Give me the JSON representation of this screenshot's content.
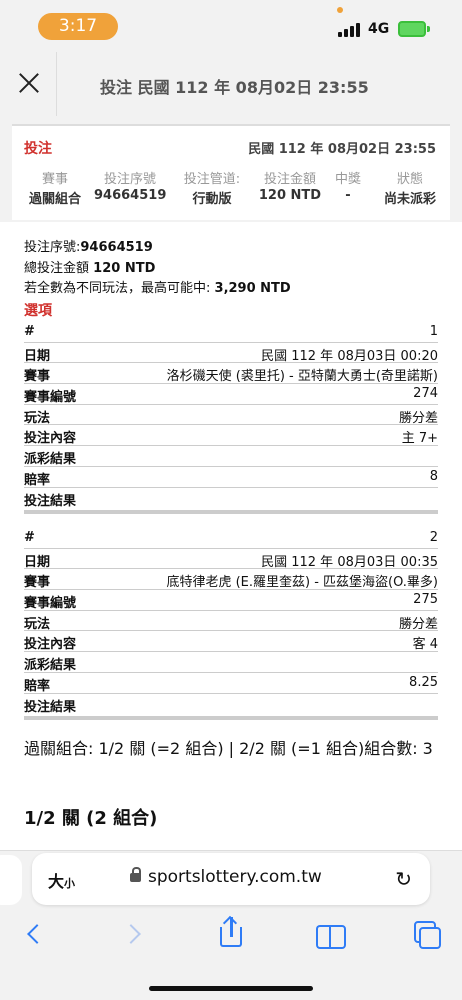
{
  "status_bar": {
    "time": "3:17",
    "network": "4G",
    "accent": "#f0a23a"
  },
  "header": {
    "title": "投注 民國 112 年 08月02日 23:55",
    "close_icon": "close-icon"
  },
  "card": {
    "title": "投注",
    "date": "民國 112 年 08月02日 23:55",
    "columns": [
      {
        "header": "賽事",
        "value": "過關組合"
      },
      {
        "header": "投注序號",
        "value": "94664519"
      },
      {
        "header": "投注管道:",
        "value": "行動版"
      },
      {
        "header": "投注金額",
        "value": "120 NTD"
      },
      {
        "header": "中獎",
        "value": "-"
      },
      {
        "header": "狀態",
        "value": "尚未派彩"
      }
    ]
  },
  "details": {
    "serial_label": "投注序號:",
    "serial_value": "94664519",
    "total_label": "總投注金額",
    "total_value": "120 NTD",
    "max_label": "若全數為不同玩法，最高可能中:",
    "max_value": "3,290 NTD",
    "selections_title": "選項",
    "labels": {
      "num": "#",
      "date": "日期",
      "match": "賽事",
      "match_no": "賽事編號",
      "play": "玩法",
      "content": "投注內容",
      "payout": "派彩結果",
      "odds": "賠率",
      "result": "投注結果"
    },
    "legs": [
      {
        "num": "1",
        "date": "民國 112 年 08月03日 00:20",
        "match": "洛杉磯天使 (裘里托) - 亞特蘭大勇士(奇里諾斯)",
        "match_no": "274",
        "play": "勝分差",
        "content": "主 7+",
        "payout": "",
        "odds": "8",
        "result": ""
      },
      {
        "num": "2",
        "date": "民國 112 年 08月03日 00:35",
        "match": "底特律老虎 (E.羅里奎茲) - 匹茲堡海盜(O.畢多)",
        "match_no": "275",
        "play": "勝分差",
        "content": "客 4",
        "payout": "",
        "odds": "8.25",
        "result": ""
      }
    ],
    "summary": "過關組合: 1/2 關 (=2 組合) | 2/2 關 (=1 組合)組合數: 3",
    "pass_title": "1/2 關 (2 組合)"
  },
  "browser": {
    "text_size": "大",
    "text_size_small": "小",
    "url": "sportslottery.com.tw",
    "link_color": "#2f7cf6"
  }
}
